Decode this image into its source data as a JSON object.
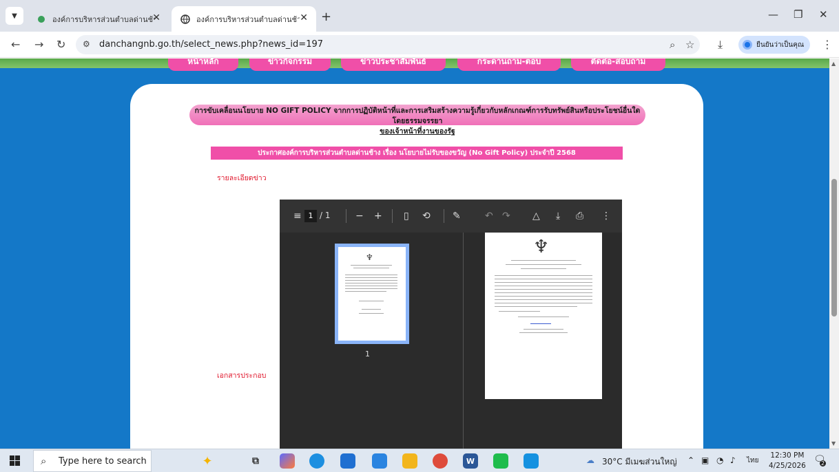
{
  "browser": {
    "tabs": [
      {
        "title": "องค์การบริหารส่วนตำบลด่านช้าง อำเ",
        "active": false,
        "favicon": "green-site-icon"
      },
      {
        "title": "องค์การบริหารส่วนตำบลด่านช้าง อำเ",
        "active": true,
        "favicon": "globe-icon"
      }
    ],
    "url": "danchangnb.go.th/select_news.php?news_id=197",
    "profile_label": "ยืนยันว่าเป็นคุณ"
  },
  "site": {
    "nav": [
      "หน้าหลัก",
      "ข่าวกิจกรรม",
      "ข่าวประชาสัมพันธ์",
      "กระดานถาม-ตอบ",
      "ติดต่อ-สอบถาม"
    ],
    "headline_line1": "การขับเคลื่อนนโยบาย NO GIFT POLICY จากการปฏิบัติหน้าที่และการเสริมสร้างความรู้เกี่ยวกับหลักเกณฑ์การรับทรัพย์สินหรือประโยชน์อื่นใดโดยธรรมจรรยา",
    "headline_line2": "ของเจ้าหน้าที่งานของรัฐ",
    "announcement": "ประกาศองค์การบริหารส่วนตำบลด่านช้าง เรื่อง นโยบายไม่รับของขวัญ (No Gift Policy) ประจำปี 2568",
    "details_label": "รายละเอียดข่าว",
    "attachments_label": "เอกสารประกอบ"
  },
  "pdf_viewer": {
    "current_page": "1",
    "page_count": "/ 1",
    "thumbnail_label": "1",
    "toolbar_icons": [
      "menu-icon",
      "zoom-out-icon",
      "zoom-in-icon",
      "fit-page-icon",
      "rotate-icon",
      "draw-icon",
      "undo-icon",
      "redo-icon",
      "drive-icon",
      "download-icon",
      "print-icon",
      "more-icon"
    ]
  },
  "taskbar": {
    "search_placeholder": "Type here to search",
    "weather": "30°C มีเมฆส่วนใหญ่",
    "language": "ไทย",
    "time": "12:30 PM",
    "date": "4/25/2026",
    "notifications": "2"
  },
  "colors": {
    "page_bg": "#1478c8",
    "pink": "#f04fa8",
    "red_label": "#e0162b"
  }
}
